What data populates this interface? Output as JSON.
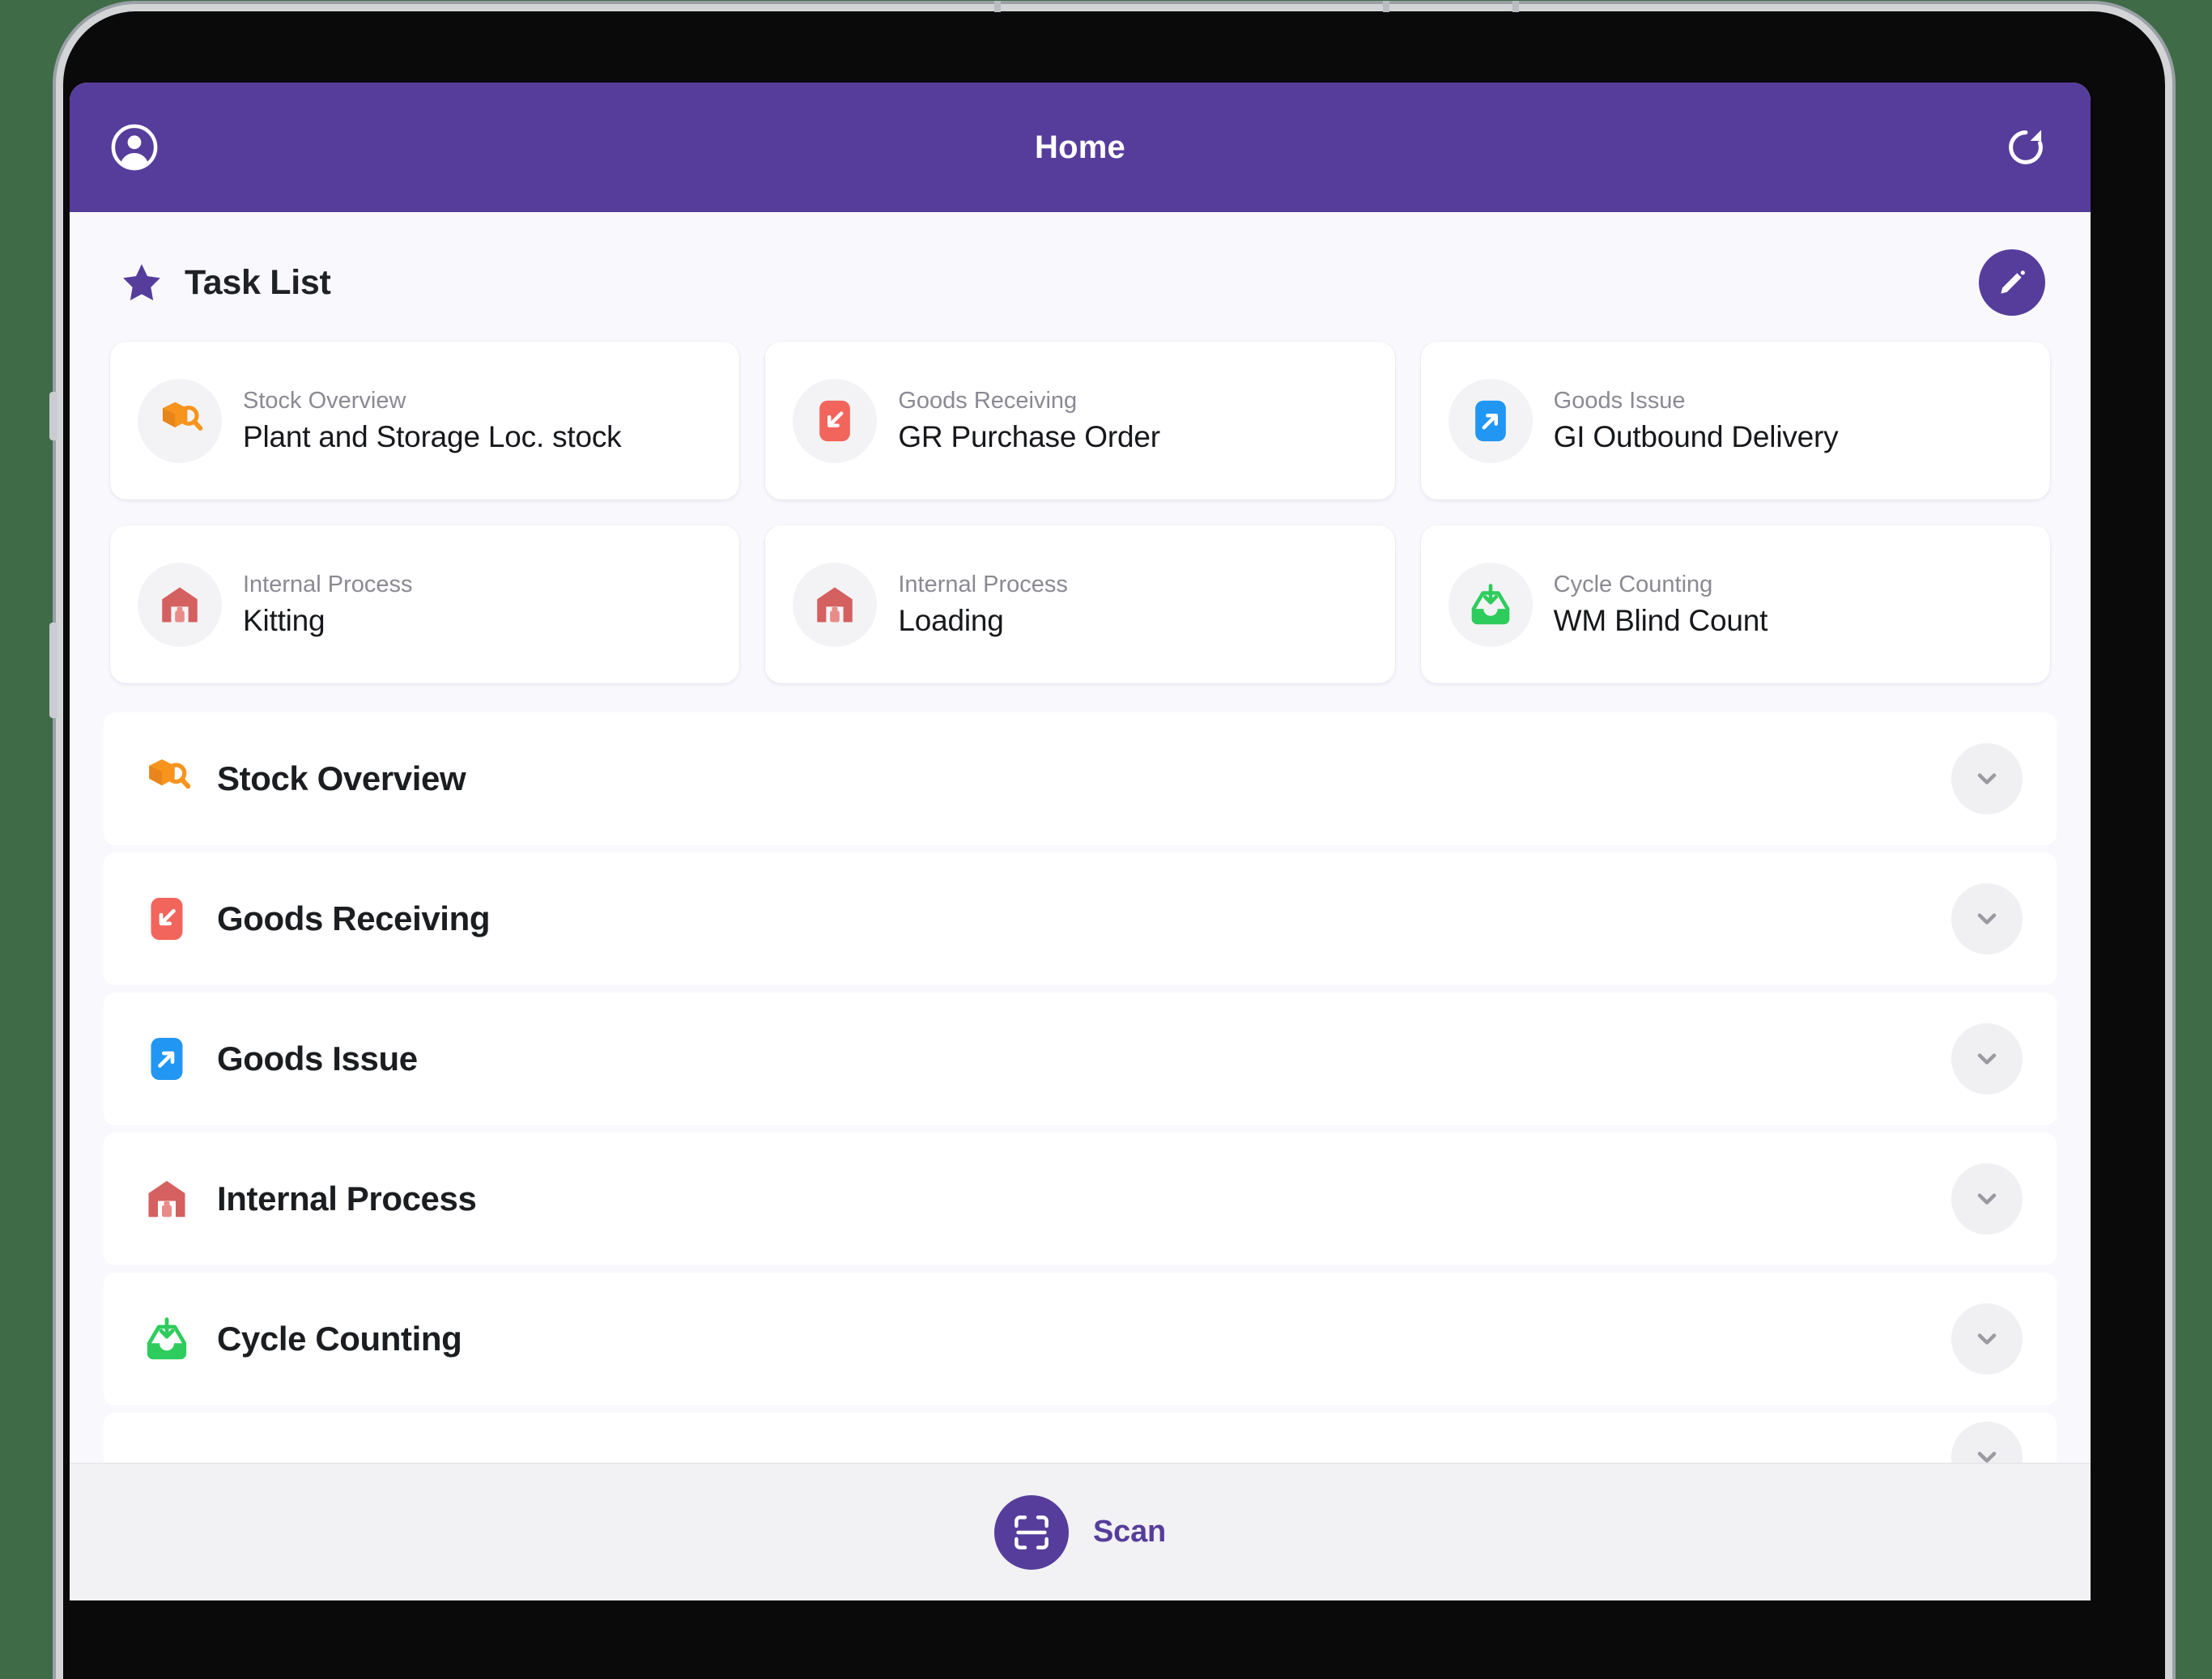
{
  "app_bar": {
    "title": "Home",
    "account_icon": "account-circle-icon",
    "refresh_icon": "refresh-icon",
    "background_color": "#563D9C"
  },
  "task_list": {
    "title": "Task List",
    "star_icon": "star-icon",
    "star_color": "#563D9C",
    "edit_icon": "pencil-edit-icon",
    "edit_button_color": "#563D9C",
    "cards": [
      {
        "category": "Stock Overview",
        "title": "Plant and Storage Loc. stock",
        "icon": "box-search-icon",
        "icon_color": "#F7941D"
      },
      {
        "category": "Goods Receiving",
        "title": "GR Purchase Order",
        "icon": "arrow-down-left-icon",
        "icon_color": "#F2655C"
      },
      {
        "category": "Goods Issue",
        "title": "GI Outbound Delivery",
        "icon": "arrow-up-right-icon",
        "icon_color": "#2196F3"
      },
      {
        "category": "Internal Process",
        "title": "Kitting",
        "icon": "warehouse-icon",
        "icon_color": "#D4605F"
      },
      {
        "category": "Internal Process",
        "title": "Loading",
        "icon": "warehouse-icon",
        "icon_color": "#D4605F"
      },
      {
        "category": "Cycle Counting",
        "title": "WM Blind Count",
        "icon": "inbox-download-icon",
        "icon_color": "#2ECC5C"
      }
    ]
  },
  "sections": [
    {
      "label": "Stock Overview",
      "icon": "box-search-icon",
      "icon_color": "#F7941D",
      "chevron": "chevron-down-icon",
      "expanded": false
    },
    {
      "label": "Goods Receiving",
      "icon": "arrow-down-left-icon",
      "icon_color": "#F2655C",
      "chevron": "chevron-down-icon",
      "expanded": false
    },
    {
      "label": "Goods Issue",
      "icon": "arrow-up-right-icon",
      "icon_color": "#2196F3",
      "chevron": "chevron-down-icon",
      "expanded": false
    },
    {
      "label": "Internal Process",
      "icon": "warehouse-icon",
      "icon_color": "#D4605F",
      "chevron": "chevron-down-icon",
      "expanded": false
    },
    {
      "label": "Cycle Counting",
      "icon": "inbox-download-icon",
      "icon_color": "#2ECC5C",
      "chevron": "chevron-down-icon",
      "expanded": false
    }
  ],
  "scan_bar": {
    "label": "Scan",
    "icon": "barcode-scan-icon",
    "accent_color": "#563D9C"
  },
  "theme": {
    "accent": "#563D9C",
    "page_background": "#F9F8FD",
    "card_background": "#FFFFFF",
    "muted_text": "#8A8A92",
    "primary_text": "#17181B"
  }
}
